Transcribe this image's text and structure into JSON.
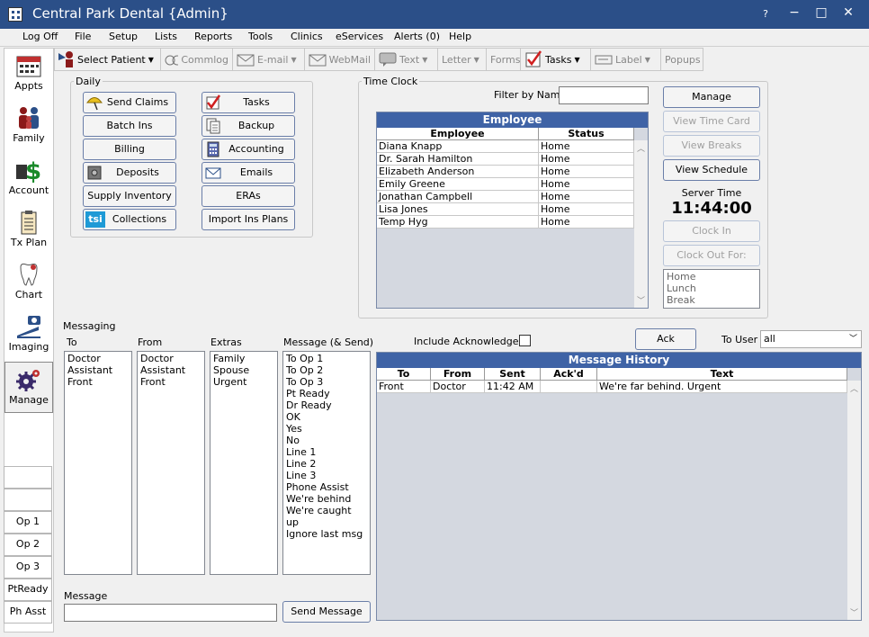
{
  "window": {
    "title": "Central Park Dental {Admin}",
    "help": "?",
    "minimize": "−",
    "maximize": "□",
    "close": "✕"
  },
  "menu": [
    "Log Off",
    "File",
    "Setup",
    "Lists",
    "Reports",
    "Tools",
    "Clinics",
    "eServices",
    "Alerts (0)",
    "Help"
  ],
  "toolbar": {
    "select_patient": "Select Patient",
    "commlog": "Commlog",
    "email": "E-mail",
    "webmail": "WebMail",
    "text": "Text",
    "letter": "Letter",
    "forms": "Forms",
    "tasks": "Tasks",
    "label": "Label",
    "popups": "Popups"
  },
  "modules": [
    "Appts",
    "Family",
    "Account",
    "Tx Plan",
    "Chart",
    "Imaging",
    "Manage"
  ],
  "ops": [
    "Op 1",
    "Op 2",
    "Op 3",
    "PtReady",
    "Ph Asst"
  ],
  "daily": {
    "title": "Daily",
    "send_claims": "Send Claims",
    "tasks": "Tasks",
    "batch_ins": "Batch Ins",
    "backup": "Backup",
    "billing": "Billing",
    "accounting": "Accounting",
    "deposits": "Deposits",
    "emails": "Emails",
    "supply_inventory": "Supply Inventory",
    "eras": "ERAs",
    "collections": "Collections",
    "import_ins_plans": "Import Ins Plans",
    "tsi": "tsi"
  },
  "timeclock": {
    "title": "Time Clock",
    "filter_label": "Filter by Name",
    "filter_value": "",
    "grid_title": "Employee",
    "col_employee": "Employee",
    "col_status": "Status",
    "employees": [
      {
        "name": "Diana  Knapp",
        "status": "Home"
      },
      {
        "name": "Dr. Sarah  Hamilton",
        "status": "Home"
      },
      {
        "name": "Elizabeth  Anderson",
        "status": "Home"
      },
      {
        "name": "Emily  Greene",
        "status": "Home"
      },
      {
        "name": "Jonathan  Campbell",
        "status": "Home"
      },
      {
        "name": "Lisa  Jones",
        "status": "Home"
      },
      {
        "name": "Temp  Hyg",
        "status": "Home"
      }
    ],
    "manage": "Manage",
    "view_time_card": "View Time Card",
    "view_breaks": "View Breaks",
    "view_schedule": "View Schedule",
    "server_time_label": "Server Time",
    "server_time": "11:44:00",
    "clock_in": "Clock In",
    "clock_out_for": "Clock Out For:",
    "clock_out_options": [
      "Home",
      "Lunch",
      "Break"
    ]
  },
  "messaging": {
    "title": "Messaging",
    "to_label": "To",
    "from_label": "From",
    "extras_label": "Extras",
    "message_label": "Message (& Send)",
    "to": [
      "Doctor",
      "Assistant",
      "Front"
    ],
    "from": [
      "Doctor",
      "Assistant",
      "Front"
    ],
    "extras": [
      "Family",
      "Spouse",
      "Urgent"
    ],
    "messages": [
      "To Op 1",
      "To Op 2",
      "To Op 3",
      "Pt Ready",
      "Dr Ready",
      "OK",
      "Yes",
      "No",
      "Line 1",
      "Line 2",
      "Line 3",
      "Phone Assist",
      "We're behind",
      "We're caught up",
      "Ignore last msg"
    ],
    "message_field_label": "Message",
    "message_value": "",
    "send_message": "Send Message",
    "include_ack": "Include Acknowledged",
    "ack": "Ack",
    "to_user_label": "To User",
    "to_user_value": "all"
  },
  "history": {
    "title": "Message History",
    "col_to": "To",
    "col_from": "From",
    "col_sent": "Sent",
    "col_ackd": "Ack'd",
    "col_text": "Text",
    "rows": [
      {
        "to": "Front",
        "from": "Doctor",
        "sent": "11:42 AM",
        "ackd": "",
        "text": "We're far behind.  Urgent"
      }
    ]
  },
  "colors": {
    "title_bar": "#2b4f88",
    "grid_header": "#3f63a6",
    "panel_bg": "#f0f0f0"
  }
}
